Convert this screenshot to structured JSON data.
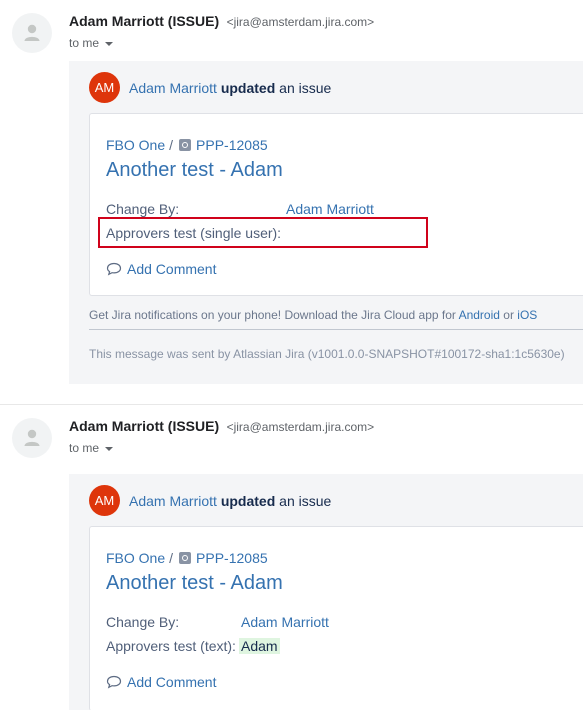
{
  "emails": [
    {
      "sender_name": "Adam Marriott (ISSUE)",
      "sender_email": "<jira@amsterdam.jira.com>",
      "to": "to me",
      "badge": "AM",
      "actor": "Adam Marriott",
      "action_bold": "updated",
      "action_rest": "an issue",
      "project": "FBO One",
      "separator": "/",
      "issue_key": "PPP-12085",
      "issue_title": "Another test - Adam",
      "field1_label": "Change By:",
      "field1_value": "Adam Marriott",
      "field2_label": "Approvers test (single user):",
      "comment": "Add Comment",
      "footer_text": "Get Jira notifications on your phone! Download the Jira Cloud app for",
      "footer_android": "Android",
      "footer_or": "or",
      "footer_ios": "iOS",
      "sent_by": "This message was sent by Atlassian Jira (v1001.0.0-SNAPSHOT#100172-sha1:1c5630e)"
    },
    {
      "sender_name": "Adam Marriott (ISSUE)",
      "sender_email": "<jira@amsterdam.jira.com>",
      "to": "to me",
      "badge": "AM",
      "actor": "Adam Marriott",
      "action_bold": "updated",
      "action_rest": "an issue",
      "project": "FBO One",
      "separator": "/",
      "issue_key": "PPP-12085",
      "issue_title": "Another test - Adam",
      "field1_label": "Change By:",
      "field1_value": "Adam Marriott",
      "field2_label": "Approvers test (text):",
      "field2_value": "Adam",
      "comment": "Add Comment"
    }
  ],
  "colors": {
    "link": "#3572b0",
    "badge": "#de350b",
    "highlight": "#d0021b",
    "added_value_bg": "#dff5e0"
  }
}
